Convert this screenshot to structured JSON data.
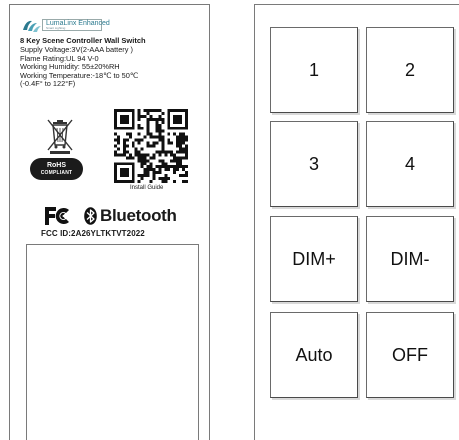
{
  "brand": {
    "name": "LumaLinx Enhanced",
    "tagline": "Smart Lighting"
  },
  "label": {
    "title": "8 Key Scene Controller Wall Switch",
    "specs": [
      "Supply Voltage:3V(2-AAA battery )",
      "Flame Rating:UL 94 V-0",
      "Working Humidity: 55±20%RH",
      "Working Temperature:-18℃ to 50℃",
      "(-0.4F° to 122°F)"
    ],
    "rohs_name": "RoHS",
    "rohs_sub": "COMPLIANT",
    "qr_caption": "Install Guide",
    "fcc_logo": "FC",
    "bluetooth_text": "Bluetooth",
    "fcc_id": "FCC ID:2A26YLTKTVT2022",
    "icons": [
      "weee-bin-icon",
      "qr-code-icon",
      "fcc-logo-icon",
      "bluetooth-icon"
    ]
  },
  "keypad": {
    "keys": [
      "1",
      "2",
      "3",
      "4",
      "DIM+",
      "DIM-",
      "Auto",
      "OFF"
    ]
  },
  "colors": {
    "brand": "#2b7a8f",
    "ink": "#1a1a1a",
    "border": "#7a7a7a"
  }
}
